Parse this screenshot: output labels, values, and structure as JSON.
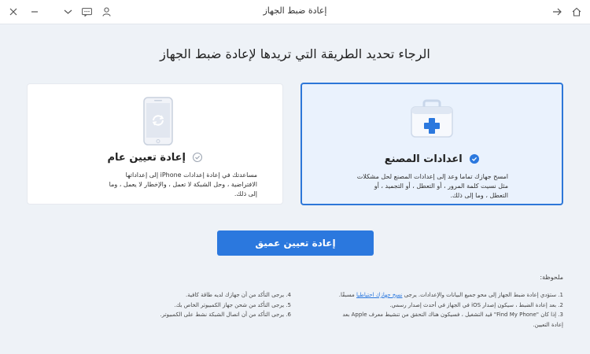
{
  "window": {
    "title": "إعادة ضبط الجهاز"
  },
  "heading": "الرجاء تحديد الطريقة التي تريدها لإعادة ضبط الجهاز",
  "cards": {
    "factory": {
      "title": "اعدادات المصنع",
      "desc_lines": [
        "امسح جهازك تماما وعد إلى إعدادات المصنع لحل مشكلات",
        "مثل نسيت كلمة المرور ، أو التعطل ، أو التجميد ، أو",
        "التعطل ، وما إلى ذلك."
      ],
      "selected": true
    },
    "general": {
      "title": "إعادة تعيين عام",
      "desc_lines": [
        "مساعدتك في إعادة إعدادات iPhone إلى إعداداتها",
        "الافتراضية ، وحل الشبكة لا تعمل ، والإخطار لا يعمل ، وما",
        "إلى ذلك."
      ],
      "selected": false
    }
  },
  "deep_reset_button": "إعادة تعيين عميق",
  "notes": {
    "title": "ملحوظة:",
    "right_col": {
      "line1_before": "1. ستؤدي إعادة ضبط الجهاز إلى محو جميع البيانات والإعدادات. يرجى ",
      "line1_link": "نسخ جهازك احتياطيا",
      "line1_after": " مسبقًا.",
      "line2": "2. بعد إعادة الضبط ، سيكون إصدار iOS في الجهاز في أحدث إصدار رسمي.",
      "line3": "3. إذا كان \"Find My Phone\" قيد التشغيل ، فسيكون هناك التحقق من تنشيط معرف Apple بعد",
      "line4": "إعادة التعيين."
    },
    "left_col": [
      "4. يرجى التأكد من أن جهازك لديه طاقة كافية.",
      "5. يرجى التأكد من شحن جهاز الكمبيوتر الخاص بك.",
      "6. يرجى التأكد من أن اتصال الشبكة نشط على الكمبيوتر."
    ]
  },
  "colors": {
    "accent": "#2b78de",
    "background": "#eef2f7"
  }
}
